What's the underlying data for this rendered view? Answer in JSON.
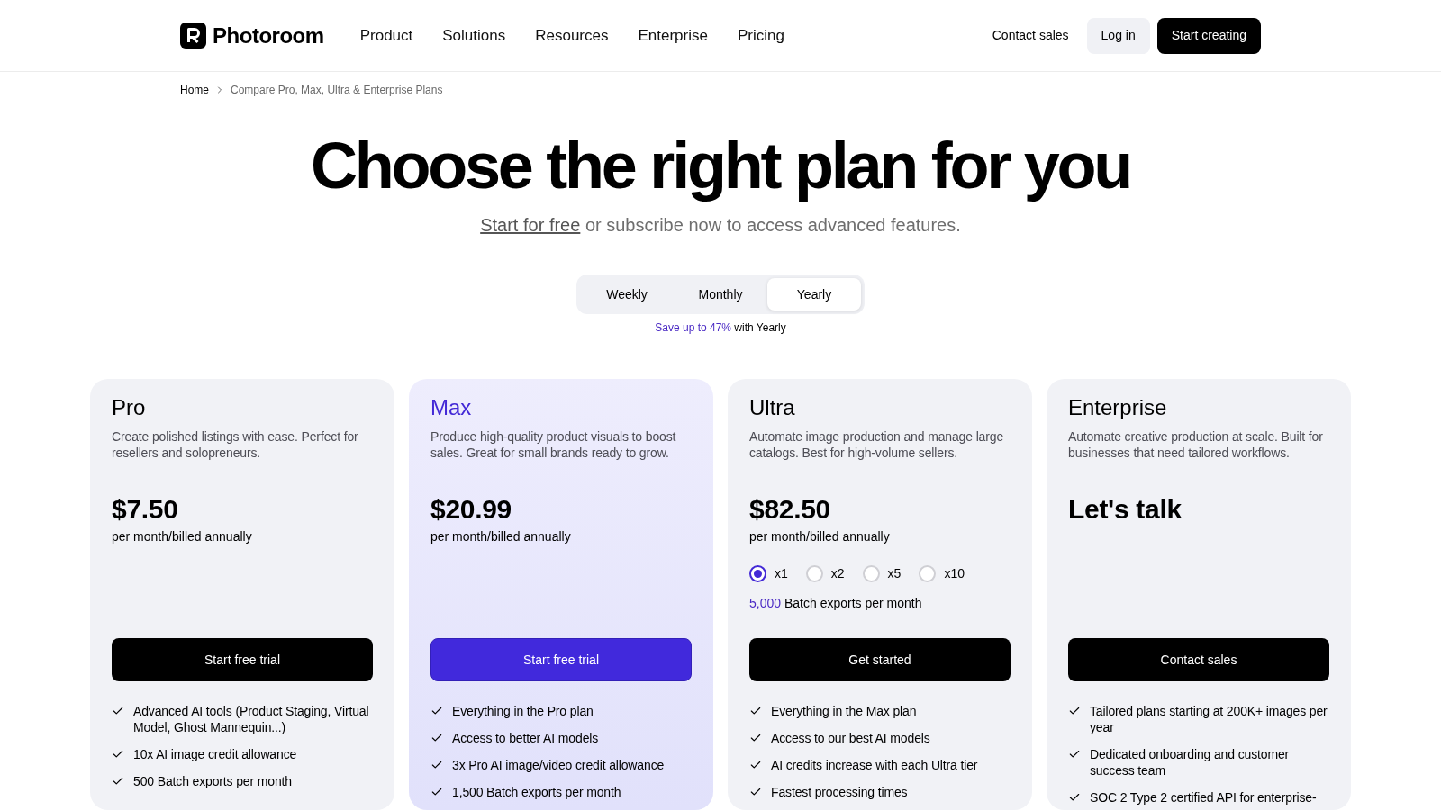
{
  "header": {
    "logo": "Photoroom",
    "nav": [
      "Product",
      "Solutions",
      "Resources",
      "Enterprise",
      "Pricing"
    ],
    "actions": [
      {
        "label": "Contact sales",
        "kind": "link"
      },
      {
        "label": "Log in",
        "kind": "secondary"
      },
      {
        "label": "Start creating",
        "kind": "primary"
      }
    ]
  },
  "breadcrumb": [
    {
      "label": "Home"
    },
    {
      "label": "Compare Pro, Max, Ultra & Enterprise Plans"
    }
  ],
  "hero": {
    "title": "Choose the right plan for you",
    "subtitle": {
      "link": "Start for free",
      "text": "or subscribe now to access advanced features."
    }
  },
  "billing": {
    "options": [
      {
        "label": "Weekly",
        "selected": false
      },
      {
        "label": "Monthly",
        "selected": false
      },
      {
        "label": "Yearly",
        "selected": true
      }
    ],
    "note": {
      "highlight": "Save up to 47%",
      "text": "with Yearly"
    }
  },
  "plans": [
    {
      "name": "Pro",
      "featured": false,
      "description": "Create polished listings with ease. Perfect for resellers and solopreneurs.",
      "price": "$7.50",
      "period": "per month/billed annually",
      "button": "Start free trial",
      "features": [
        "Advanced AI tools (Product Staging, Virtual Model, Ghost Mannequin...)",
        "10x AI image credit allowance",
        "500 Batch exports per month"
      ]
    },
    {
      "name": "Max",
      "featured": true,
      "description": "Produce high-quality product visuals to boost sales. Great for small brands ready to grow.",
      "price": "$20.99",
      "period": "per month/billed annually",
      "button": "Start free trial",
      "features": [
        "Everything in the Pro plan",
        "Access to better AI models",
        "3x Pro AI image/video credit allowance",
        "1,500 Batch exports per month"
      ]
    },
    {
      "name": "Ultra",
      "featured": false,
      "description": "Automate image production and manage large catalogs. Best for high-volume sellers.",
      "price": "$82.50",
      "period": "per month/billed annually",
      "tiers": [
        {
          "label": "x1",
          "selected": true
        },
        {
          "label": "x2",
          "selected": false
        },
        {
          "label": "x5",
          "selected": false
        },
        {
          "label": "x10",
          "selected": false
        }
      ],
      "batch": {
        "count": "5,000",
        "text": "Batch exports per month"
      },
      "button": "Get started",
      "features": [
        "Everything in the Max plan",
        "Access to our best AI models",
        "AI credits increase with each Ultra tier",
        "Fastest processing times"
      ]
    },
    {
      "name": "Enterprise",
      "featured": false,
      "description": "Automate creative production at scale. Built for businesses that need tailored workflows.",
      "price": "Let's talk",
      "button": "Contact sales",
      "features": [
        "Tailored plans starting at 200K+ images per year",
        "Dedicated onboarding and customer success team",
        "SOC 2 Type 2 certified API for enterprise-"
      ]
    }
  ]
}
